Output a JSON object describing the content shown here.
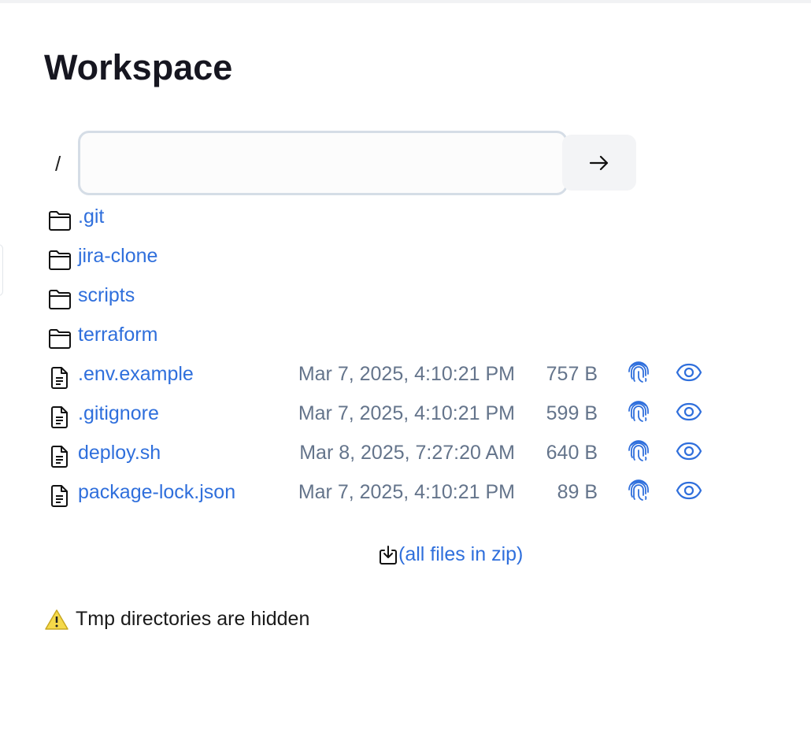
{
  "title": "Workspace",
  "path": {
    "root": "/",
    "value": "",
    "go_icon": "arrow-right-icon"
  },
  "folders": [
    {
      "name": ".git"
    },
    {
      "name": "jira-clone"
    },
    {
      "name": "scripts"
    },
    {
      "name": "terraform"
    }
  ],
  "files": [
    {
      "name": ".env.example",
      "date": "Mar 7, 2025, 4:10:21 PM",
      "size": "757 B"
    },
    {
      "name": ".gitignore",
      "date": "Mar 7, 2025, 4:10:21 PM",
      "size": "599 B"
    },
    {
      "name": "deploy.sh",
      "date": "Mar 8, 2025, 7:27:20 AM",
      "size": "640 B"
    },
    {
      "name": "package-lock.json",
      "date": "Mar 7, 2025, 4:10:21 PM",
      "size": "89 B"
    }
  ],
  "zip_label": "(all files in zip)",
  "warning": "Tmp directories are hidden",
  "colors": {
    "link": "#2f6fdc",
    "muted": "#64748b"
  }
}
